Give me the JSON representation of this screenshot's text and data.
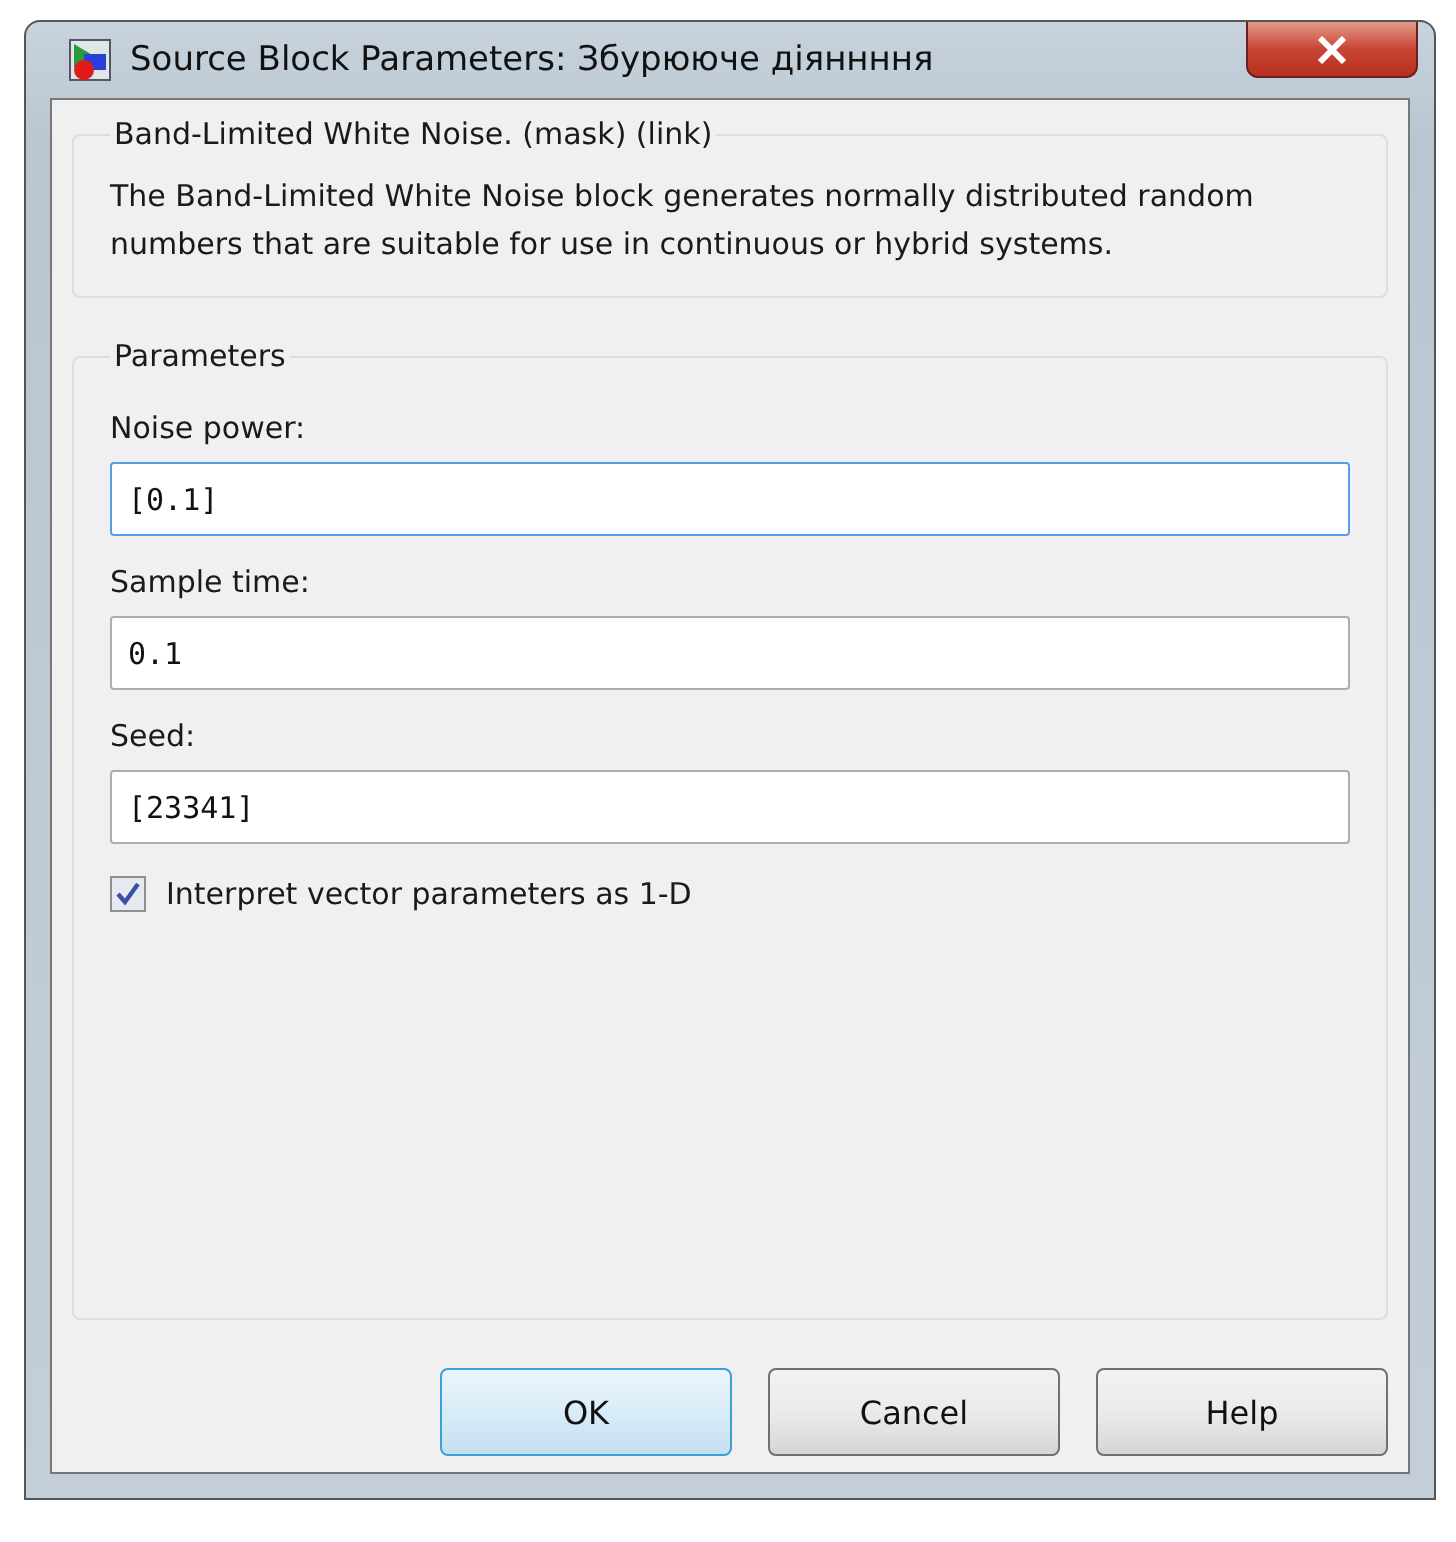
{
  "window": {
    "title": "Source Block Parameters: Збурююче діяннння"
  },
  "description": {
    "title": "Band-Limited White Noise. (mask) (link)",
    "text": "The Band-Limited White Noise block generates normally distributed random numbers that are suitable for use in continuous or hybrid systems."
  },
  "parameters": {
    "title": "Parameters",
    "fields": [
      {
        "label": "Noise power:",
        "value": "[0.1]",
        "focused": true
      },
      {
        "label": "Sample time:",
        "value": "0.1",
        "focused": false
      },
      {
        "label": "Seed:",
        "value": "[23341]",
        "focused": false
      }
    ],
    "checkbox": {
      "label": "Interpret vector parameters as 1-D",
      "checked": true
    }
  },
  "buttons": [
    {
      "label": "OK",
      "default": true
    },
    {
      "label": "Cancel",
      "default": false
    },
    {
      "label": "Help",
      "default": false
    }
  ]
}
